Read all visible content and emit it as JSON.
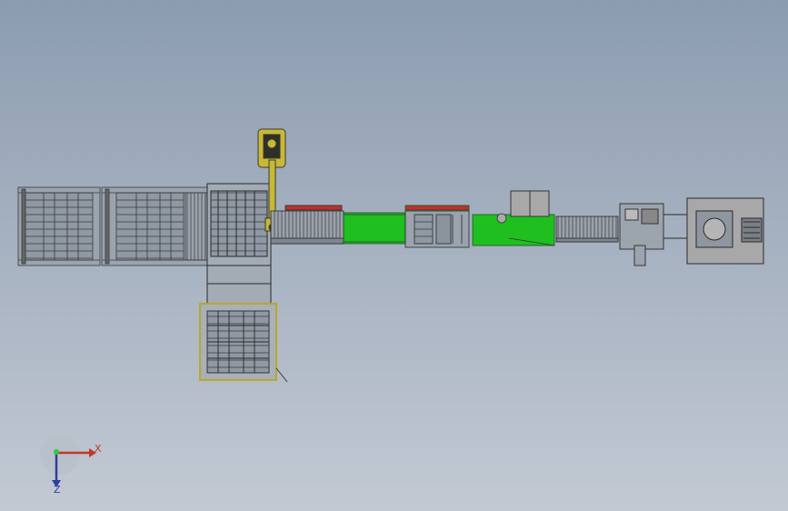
{
  "axes": {
    "x_label": "X",
    "z_label": "Z",
    "x_color": "#c0392b",
    "y_color": "#2ecc40",
    "z_color": "#2c3e9e"
  },
  "colors": {
    "background_top": "#8c9cb0",
    "background_bottom": "#c2c9d3",
    "line": "#3a3a3a",
    "conveyor_green": "#1fbf1f",
    "robot_yellow": "#c8b838",
    "frame_yellow": "#b8a82a",
    "rail_red": "#c0302a",
    "machine_grey": "#a8a8a8"
  }
}
